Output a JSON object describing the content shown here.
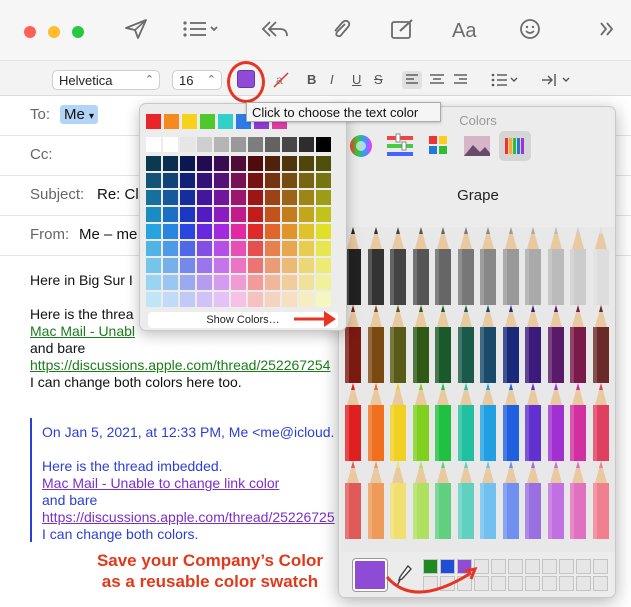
{
  "toolbar": {
    "font_name": "Helvetica",
    "font_size": "16",
    "bold": "B",
    "italic": "I",
    "underline": "U",
    "strike": "S",
    "font_button": "Aa"
  },
  "headers": {
    "to_label": "To:",
    "to_value": "Me",
    "cc_label": "Cc:",
    "subject_label": "Subject:",
    "subject_value": "Re: Cl",
    "from_label": "From:",
    "from_value": "Me – me"
  },
  "body": {
    "line1": "Here in Big Sur I",
    "line2": "Here is the threa",
    "link1": "Mac Mail - Unabl",
    "line3": "and bare",
    "link2": "https://discussions.apple.com/thread/252267254",
    "line4": "I can change both colors here too.",
    "quote_header": "On Jan 5, 2021, at 12:33 PM, Me <me@icloud.",
    "q_line1": "Here is the thread imbedded.",
    "q_link1": "Mac Mail - Unable to change link color",
    "q_line2": "and bare",
    "q_link2": "https://discussions.apple.com/thread/25226725",
    "q_line3": "I can change both colors."
  },
  "popover": {
    "tooltip": "Click to choose the text color",
    "show_colors": "Show Colors…"
  },
  "colors_panel": {
    "title": "Colors",
    "selected_color_name": "Grape",
    "current_color": "#8e4bd6"
  },
  "annotation": {
    "line1": "Save your Company’s Color",
    "line2": "as a reusable color swatch"
  },
  "colors": {
    "accent_ring": "#e83523",
    "link_green": "#1a7d1a",
    "quote_blue": "#2b3fd4",
    "link_purple": "#7b2fc7"
  }
}
